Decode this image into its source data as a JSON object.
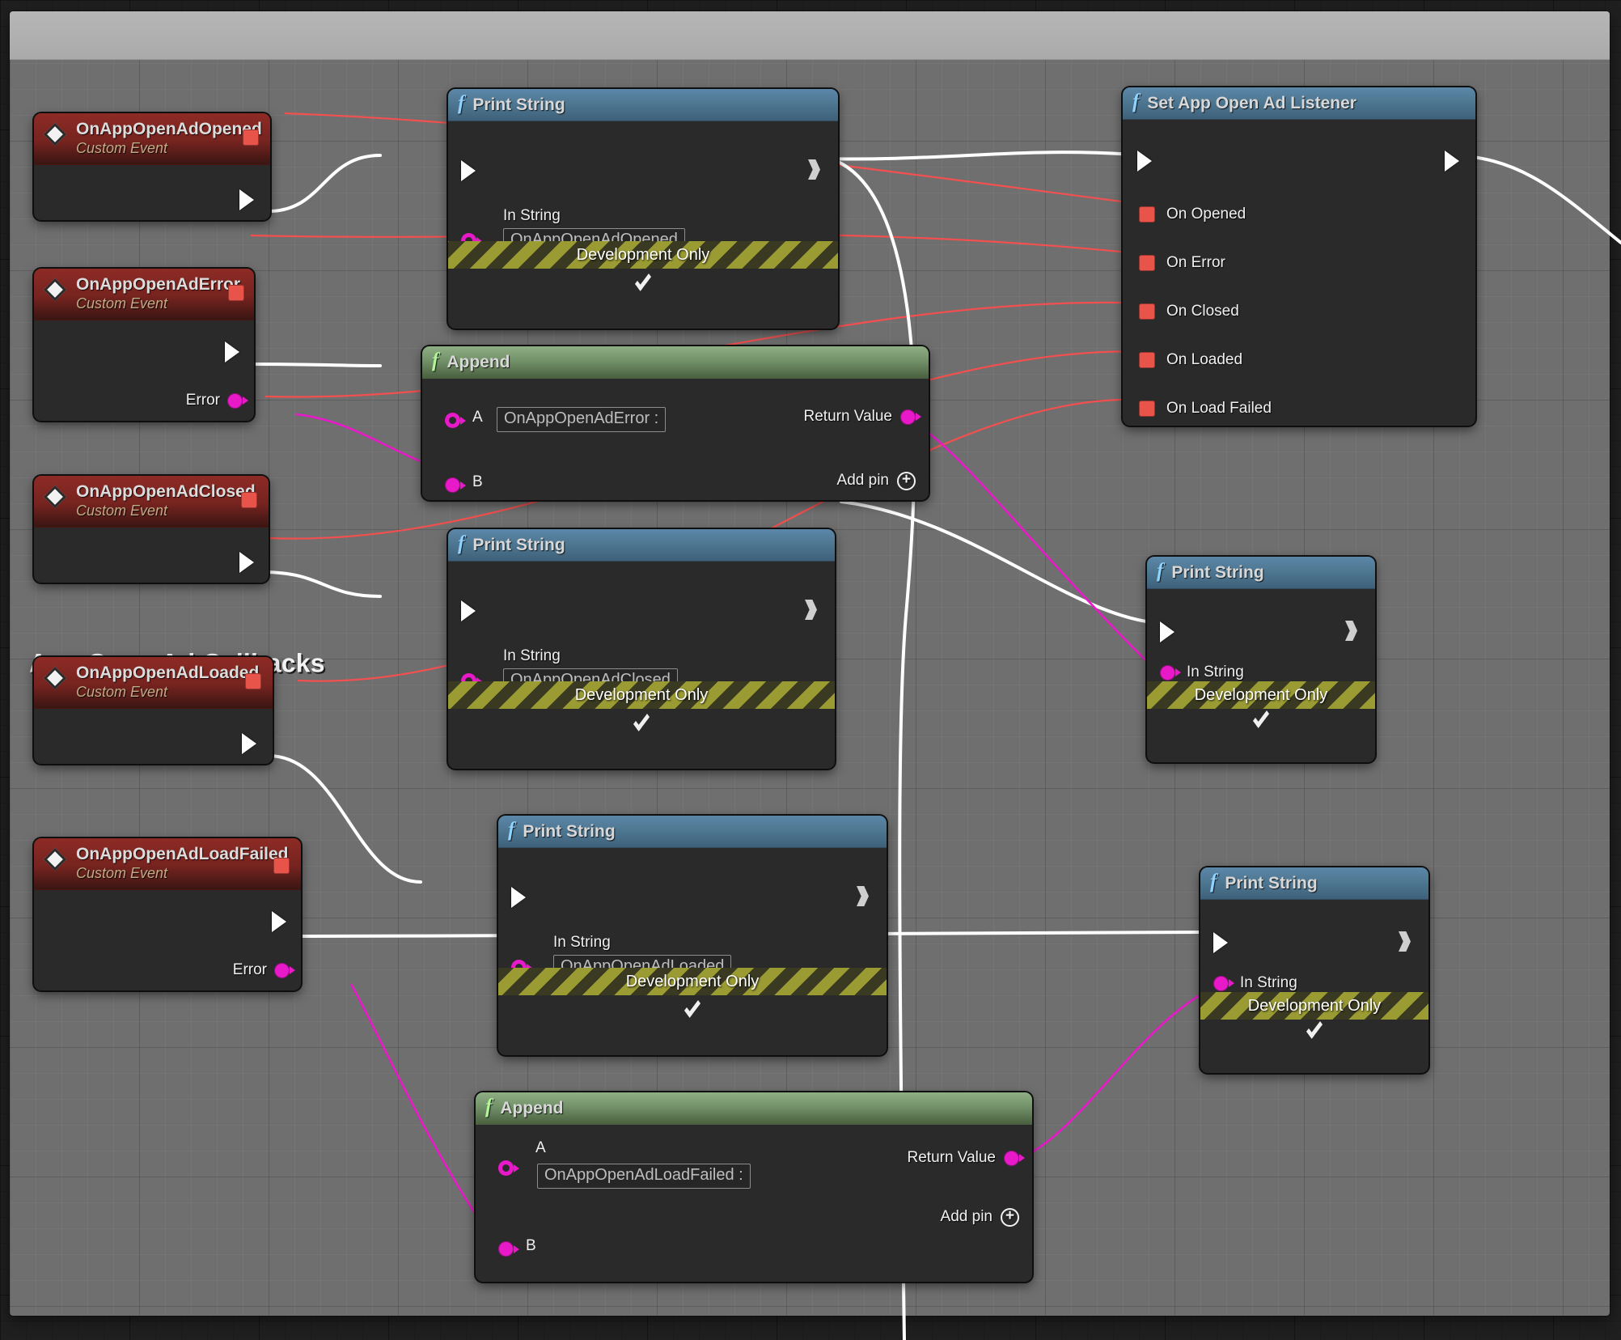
{
  "comment": {
    "title": "App Open Ad Callbacks"
  },
  "icons": {
    "function": "fx-icon",
    "event": "event-diamond-icon",
    "add_pin": "add-pin-plus-icon",
    "collapse": "chevron-down-icon"
  },
  "colors": {
    "exec_wire": "#ffffff",
    "delegate_wire": "#ff4d4d",
    "string_wire": "#e819c8",
    "event_header": "#8e2b25",
    "function_header": "#4e7792",
    "pure_header": "#73926a",
    "delegate_pin": "#e8544a",
    "string_pin": "#e819c8",
    "comment_bg": "#6f6f6f",
    "comment_header": "#b6b6b6",
    "dev_only_stripe": "#9b9b34"
  },
  "labels": {
    "custom_event": "Custom Event",
    "in_string": "In String",
    "development_only": "Development Only",
    "return_value": "Return Value",
    "add_pin": "Add pin",
    "error": "Error",
    "pin_a": "A",
    "pin_b": "B"
  },
  "events": [
    {
      "name": "OnAppOpenAdOpened",
      "subtitle": "Custom Event",
      "has_error_pin": false
    },
    {
      "name": "OnAppOpenAdError",
      "subtitle": "Custom Event",
      "has_error_pin": true,
      "error_label": "Error"
    },
    {
      "name": "OnAppOpenAdClosed",
      "subtitle": "Custom Event",
      "has_error_pin": false
    },
    {
      "name": "OnAppOpenAdLoaded",
      "subtitle": "Custom Event",
      "has_error_pin": false
    },
    {
      "name": "OnAppOpenAdLoadFailed",
      "subtitle": "Custom Event",
      "has_error_pin": true,
      "error_label": "Error"
    }
  ],
  "print_nodes": [
    {
      "title": "Print String",
      "in_string_label": "In String",
      "value": "OnAppOpenAdOpened",
      "footer": "Development Only",
      "has_value": true
    },
    {
      "title": "Print String",
      "in_string_label": "In String",
      "value": "OnAppOpenAdClosed",
      "footer": "Development Only",
      "has_value": true
    },
    {
      "title": "Print String",
      "in_string_label": "In String",
      "value": "OnAppOpenAdLoaded",
      "footer": "Development Only",
      "has_value": true
    },
    {
      "title": "Print String",
      "in_string_label": "In String",
      "value": "",
      "footer": "Development Only",
      "has_value": false
    },
    {
      "title": "Print String",
      "in_string_label": "In String",
      "value": "",
      "footer": "Development Only",
      "has_value": false
    }
  ],
  "append_nodes": [
    {
      "title": "Append",
      "a_label": "A",
      "a_value": "OnAppOpenAdError :",
      "b_label": "B",
      "return_label": "Return Value",
      "add_pin_label": "Add pin"
    },
    {
      "title": "Append",
      "a_label": "A",
      "a_value": "OnAppOpenAdLoadFailed :",
      "b_label": "B",
      "return_label": "Return Value",
      "add_pin_label": "Add pin"
    }
  ],
  "listener": {
    "title": "Set App Open Ad Listener",
    "pins": [
      {
        "label": "On Opened"
      },
      {
        "label": "On Error"
      },
      {
        "label": "On Closed"
      },
      {
        "label": "On Loaded"
      },
      {
        "label": "On Load Failed"
      }
    ]
  }
}
